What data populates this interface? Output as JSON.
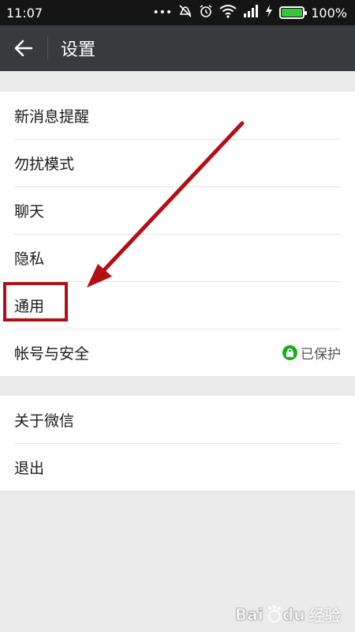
{
  "status_bar": {
    "time": "11:07",
    "icons": [
      "more-icon",
      "mute-icon",
      "alarm-icon",
      "wifi-icon",
      "signal-icon",
      "charging-icon",
      "battery-icon"
    ],
    "more_glyph": "•••",
    "battery_percent": "100%",
    "battery_level": 1.0
  },
  "header": {
    "title": "设置",
    "back_icon": "arrow-left-icon"
  },
  "settings": {
    "group1": [
      {
        "label": "新消息提醒"
      },
      {
        "label": "勿扰模式"
      },
      {
        "label": "聊天"
      },
      {
        "label": "隐私"
      },
      {
        "label": "通用"
      },
      {
        "label": "帐号与安全",
        "status": "已保护",
        "status_icon": "lock-icon"
      }
    ],
    "group2": [
      {
        "label": "关于微信"
      },
      {
        "label": "退出"
      }
    ]
  },
  "annotation": {
    "color": "#b40f14",
    "highlighted_item": "通用"
  },
  "watermark": {
    "text": "经验"
  },
  "colors": {
    "status_bar": "#151515",
    "header": "#393a3e",
    "background": "#ebebeb",
    "accent_green": "#1aad19",
    "battery_green": "#39c53a"
  }
}
